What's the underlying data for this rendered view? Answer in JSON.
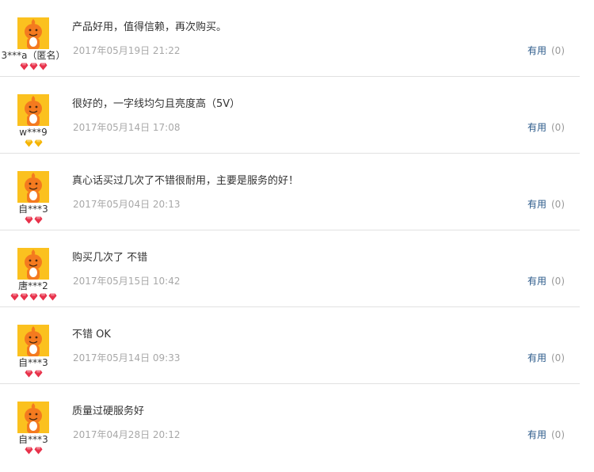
{
  "reviews": [
    {
      "username": "3***a（匿名）",
      "badge_type": "red-diamond",
      "badge_count": 3,
      "content": "产品好用，值得信赖，再次购买。",
      "date": "2017年05月19日 21:22",
      "useful_label": "有用",
      "useful_count": "(0)"
    },
    {
      "username": "w***9",
      "badge_type": "yellow-diamond",
      "badge_count": 2,
      "content": "很好的，一字线均匀且亮度高（5V）",
      "date": "2017年05月14日 17:08",
      "useful_label": "有用",
      "useful_count": "(0)"
    },
    {
      "username": "自***3",
      "badge_type": "red-diamond",
      "badge_count": 2,
      "content": "真心话买过几次了不错很耐用，主要是服务的好！",
      "date": "2017年05月04日 20:13",
      "useful_label": "有用",
      "useful_count": "(0)"
    },
    {
      "username": "唐***2",
      "badge_type": "red-diamond",
      "badge_count": 5,
      "content": "购买几次了 不错",
      "date": "2017年05月15日 10:42",
      "useful_label": "有用",
      "useful_count": "(0)"
    },
    {
      "username": "自***3",
      "badge_type": "red-diamond",
      "badge_count": 2,
      "content": "不错 OK",
      "date": "2017年05月14日 09:33",
      "useful_label": "有用",
      "useful_count": "(0)"
    },
    {
      "username": "自***3",
      "badge_type": "red-diamond",
      "badge_count": 2,
      "content": "质量过硬服务好",
      "date": "2017年04月28日 20:12",
      "useful_label": "有用",
      "useful_count": "(0)"
    }
  ],
  "colors": {
    "avatar_bg": "#fbc11f",
    "avatar_figure": "#f47a1f",
    "red_diamond": "#e8324b",
    "yellow_diamond": "#f5b400",
    "useful_link": "#2b5a8a",
    "date_text": "#a8a8a8",
    "divider": "#e1e1e1"
  }
}
